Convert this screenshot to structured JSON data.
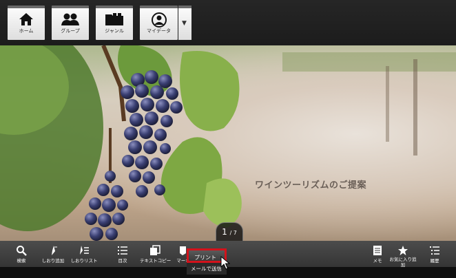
{
  "nav": {
    "home": "ホーム",
    "group": "グループ",
    "genre": "ジャンル",
    "mydata": "マイデータ",
    "more": "▼"
  },
  "hero": {
    "title": "ワインツーリズムのご提案"
  },
  "pager": {
    "current": "1",
    "total": "/ 7"
  },
  "toolbar": {
    "search": "検索",
    "bookmark_add": "しおり追加",
    "bookmark_list": "しおりリスト",
    "toc": "目次",
    "text_copy": "テキストコピー",
    "marker": "マーキ",
    "memo": "メモ",
    "favorite_add_1": "お気に入り追",
    "favorite_add_2": "加",
    "history": "履歴"
  },
  "popup": {
    "print": "プリント",
    "mail": "メールで送信"
  },
  "colors": {
    "highlight": "#d3121b",
    "toolbar": "#3f3f3f"
  }
}
